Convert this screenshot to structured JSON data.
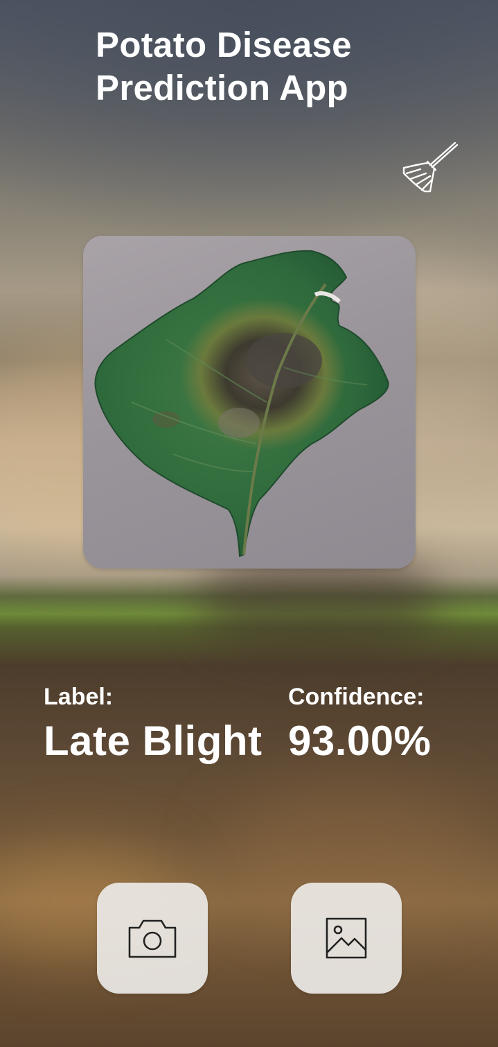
{
  "app": {
    "title": "Potato Disease Prediction App"
  },
  "toolbar": {
    "clear_icon": "broom-icon"
  },
  "image_preview": {
    "subject": "potato-leaf-photo"
  },
  "result": {
    "label_caption": "Label:",
    "label_value": "Late Blight",
    "confidence_caption": "Confidence:",
    "confidence_value": "93.00%"
  },
  "actions": {
    "camera_icon": "camera-icon",
    "gallery_icon": "image-icon"
  },
  "colors": {
    "text": "#ffffff",
    "button_bg": "#ece9e6",
    "icon_stroke": "#222222"
  }
}
